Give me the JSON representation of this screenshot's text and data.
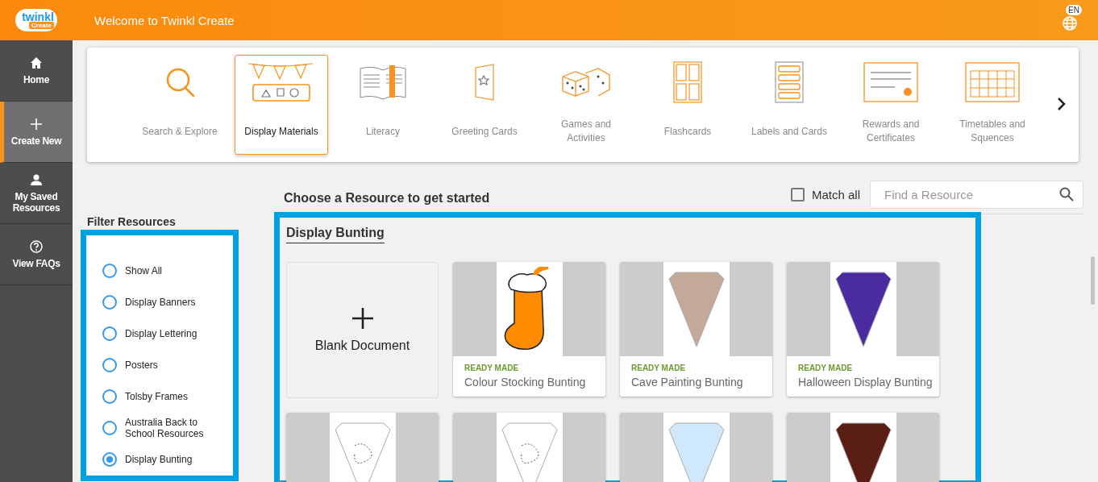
{
  "header": {
    "logo_text": "twinkl",
    "logo_badge": "Create",
    "title": "Welcome to Twinkl Create",
    "language": "EN"
  },
  "sidebar": {
    "items": [
      {
        "label": "Home",
        "selected": false
      },
      {
        "label": "Create New",
        "selected": true
      },
      {
        "label": "My Saved Resources",
        "selected": false
      },
      {
        "label": "View FAQs",
        "selected": false
      }
    ]
  },
  "categories": [
    {
      "label": "Search & Explore",
      "selected": false
    },
    {
      "label": "Display Materials",
      "selected": true
    },
    {
      "label": "Literacy",
      "selected": false
    },
    {
      "label": "Greeting Cards",
      "selected": false
    },
    {
      "label": "Games and Activities",
      "selected": false
    },
    {
      "label": "Flashcards",
      "selected": false
    },
    {
      "label": "Labels and Cards",
      "selected": false
    },
    {
      "label": "Rewards and Certificates",
      "selected": false
    },
    {
      "label": "Timetables and Squences",
      "selected": false
    }
  ],
  "filter": {
    "title": "Filter Resources",
    "options": [
      {
        "label": "Show All",
        "selected": false
      },
      {
        "label": "Display Banners",
        "selected": false
      },
      {
        "label": "Display Lettering",
        "selected": false
      },
      {
        "label": "Posters",
        "selected": false
      },
      {
        "label": "Tolsby Frames",
        "selected": false
      },
      {
        "label": "Australia Back to School Resources",
        "selected": false
      },
      {
        "label": "Display Bunting",
        "selected": true
      }
    ]
  },
  "resources": {
    "heading": "Choose a Resource to get started",
    "match_all": {
      "label": "Match all",
      "checked": false
    },
    "search": {
      "placeholder": "Find a Resource"
    },
    "section": "Display Bunting",
    "cards": [
      {
        "kind": "blank",
        "title": "Blank Document"
      },
      {
        "kind": "stocking",
        "badge": "READY MADE",
        "title": "Colour Stocking Bunting",
        "color": "#ff8c00"
      },
      {
        "kind": "pennant",
        "badge": "READY MADE",
        "title": "Cave Painting Bunting",
        "color": "#c4a898"
      },
      {
        "kind": "pennant",
        "badge": "READY MADE",
        "title": "Halloween Display Bunting",
        "color": "#4b2ca0"
      },
      {
        "kind": "outline"
      },
      {
        "kind": "outline"
      },
      {
        "kind": "pennant",
        "color": "#cfe8fb"
      },
      {
        "kind": "pennant",
        "color": "#5a1e14"
      }
    ]
  }
}
